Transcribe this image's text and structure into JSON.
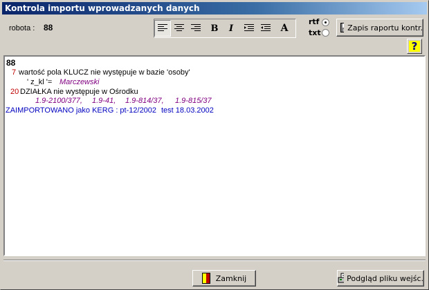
{
  "window": {
    "title": "Kontrola importu wprowadzanych danych"
  },
  "header": {
    "robota_label": "robota :",
    "robota_value": "88"
  },
  "toolbar": {
    "align_left": "align-left",
    "align_center": "align-center",
    "align_right": "align-right",
    "bold": "B",
    "italic": "I",
    "indent": "indent",
    "outdent": "outdent",
    "font": "A"
  },
  "format": {
    "rtf_label": "rtf",
    "txt_label": "txt",
    "selected": "rtf"
  },
  "buttons": {
    "save_report": "Zapis raportu kontr.",
    "close": "Zamknij",
    "preview": "Podgląd pliku wejśc."
  },
  "report": {
    "heading": "88",
    "line1_num": "7",
    "line1_text": "wartość pola KLUCZ nie występuje w bazie 'osoby'",
    "line2_key": "' z_kl '=",
    "line2_value": "Marczewski",
    "line3_num": "20",
    "line3_text": "DZIAŁKA nie występuje w Ośrodku",
    "parcels": [
      "1.9-2100/377,",
      "1.9-41,",
      "1.9-814/37,",
      "1.9-815/37"
    ],
    "footer_main": "ZAIMPORTOWANO jako KERG : pt-12/2002",
    "footer_extra": "test 18.03.2002"
  },
  "colors": {
    "error_number": "#c00000",
    "value": "#800080",
    "status": "#0000c0"
  }
}
